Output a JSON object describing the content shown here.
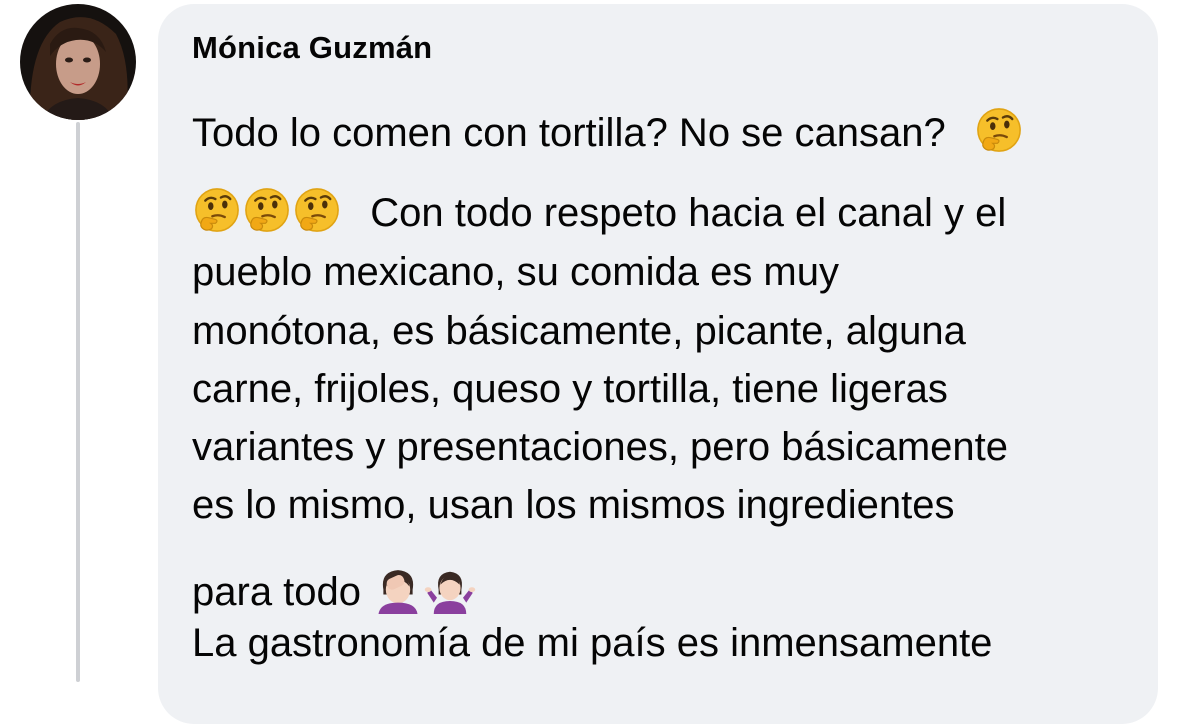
{
  "comment": {
    "author": "Mónica Guzmán",
    "lines": [
      "Todo lo comen con tortilla? No se cansan?",
      "Con todo respeto hacia el canal y el",
      "pueblo mexicano, su comida es muy",
      "monótona, es básicamente, picante, alguna",
      "carne, frijoles, queso y tortilla, tiene ligeras",
      "variantes y presentaciones, pero básicamente",
      "es lo mismo, usan los mismos ingredientes",
      "para todo",
      "La gastronomía de mi país es inmensamente"
    ],
    "emojis": {
      "line1": [
        "thinking-face-emoji"
      ],
      "line2_prefix": [
        "thinking-face-emoji",
        "thinking-face-emoji",
        "thinking-face-emoji"
      ],
      "line8": [
        "woman-facepalming-emoji",
        "woman-shrugging-emoji"
      ]
    }
  },
  "colors": {
    "bubble_bg": "#eff1f4",
    "text": "#050505",
    "thread_line": "#ced0d4"
  }
}
